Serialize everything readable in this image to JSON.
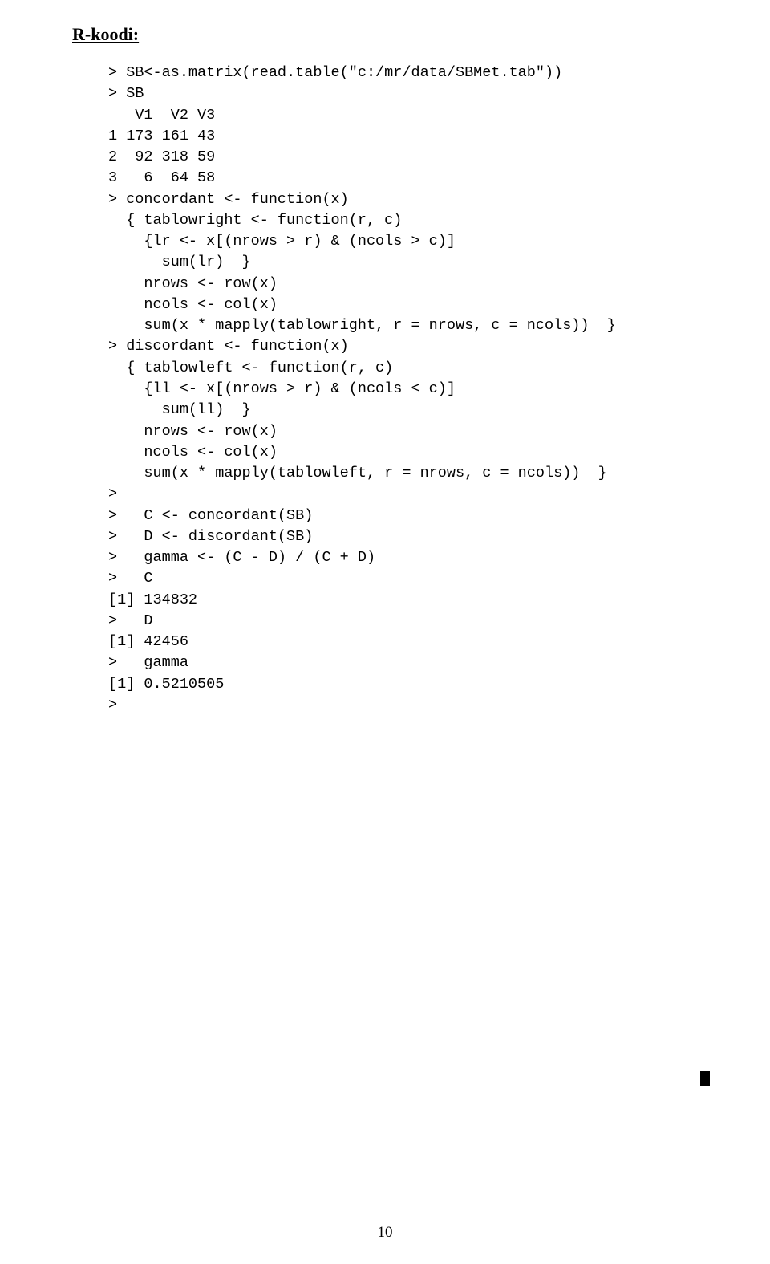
{
  "heading": "R-koodi:",
  "code": "> SB<-as.matrix(read.table(\"c:/mr/data/SBMet.tab\"))\n> SB\n   V1  V2 V3\n1 173 161 43\n2  92 318 59\n3   6  64 58\n> concordant <- function(x)\n  { tablowright <- function(r, c)\n    {lr <- x[(nrows > r) & (ncols > c)]\n      sum(lr)  }\n    nrows <- row(x)\n    ncols <- col(x)\n    sum(x * mapply(tablowright, r = nrows, c = ncols))  }\n> discordant <- function(x)\n  { tablowleft <- function(r, c)\n    {ll <- x[(nrows > r) & (ncols < c)]\n      sum(ll)  }\n    nrows <- row(x)\n    ncols <- col(x)\n    sum(x * mapply(tablowleft, r = nrows, c = ncols))  }\n>\n>   C <- concordant(SB)\n>   D <- discordant(SB)\n>   gamma <- (C - D) / (C + D)\n>   C\n[1] 134832\n>   D\n[1] 42456\n>   gamma\n[1] 0.5210505\n>",
  "page_number": "10"
}
